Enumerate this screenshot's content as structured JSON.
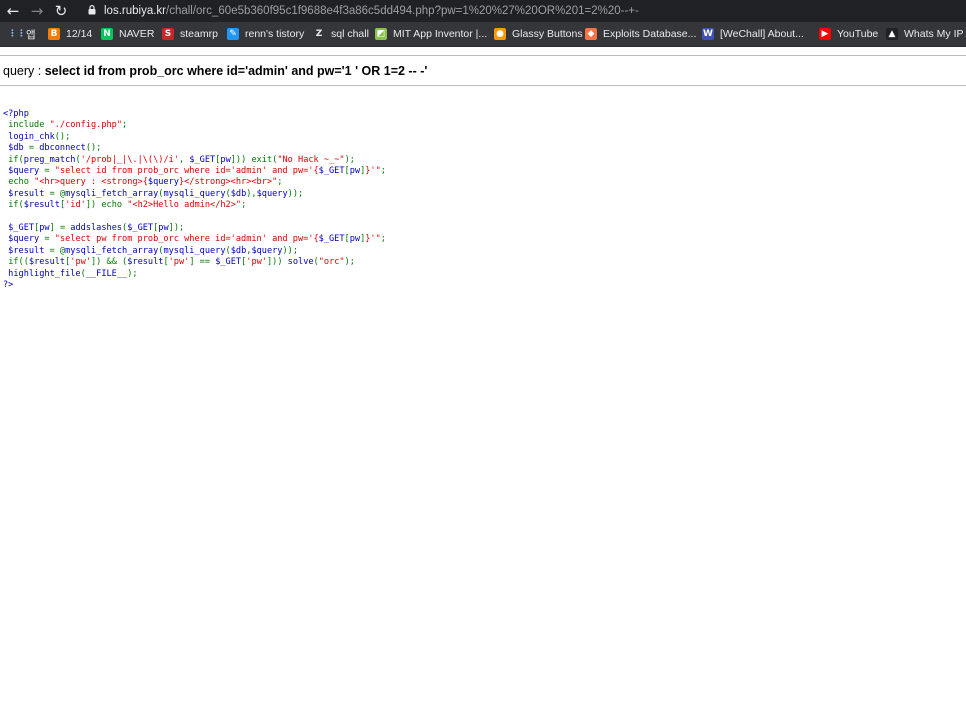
{
  "browser": {
    "url_host": "los.rubiya.kr",
    "url_path": "/chall/orc_60e5b360f95c1f9688e4f3a86c5dd494.php?pw=1%20%27%20OR%201=2%20--+-",
    "bookmarks": [
      {
        "label": "앱",
        "icon": "apps-grid-icon",
        "color": "#5f6368"
      },
      {
        "label": "12/14",
        "icon": "blogger-icon",
        "color": "#f57c00"
      },
      {
        "label": "NAVER",
        "icon": "naver-icon",
        "color": "#03c75a"
      },
      {
        "label": "steamrp",
        "icon": "steamrp-icon",
        "color": "#c62828"
      },
      {
        "label": "renn's tistory",
        "icon": "tistory-icon",
        "color": "#2196f3"
      },
      {
        "label": "sql chall",
        "icon": "z-icon",
        "color": "#e8eaed"
      },
      {
        "label": "MIT App Inventor |...",
        "icon": "app-inventor-icon",
        "color": "#8bc34a"
      },
      {
        "label": "Glassy Buttons",
        "icon": "glassy-buttons-icon",
        "color": "#ff9800"
      },
      {
        "label": "Exploits Database...",
        "icon": "exploit-db-icon",
        "color": "#ff7043"
      },
      {
        "label": "[WeChall] About...",
        "icon": "wechall-icon",
        "color": "#3f51b5"
      },
      {
        "label": "YouTube",
        "icon": "youtube-icon",
        "color": "#ff0000"
      },
      {
        "label": "Whats My IP A",
        "icon": "whatsmyip-icon",
        "color": "#202124"
      }
    ]
  },
  "page": {
    "query_label": "query : ",
    "query_value": "select id from prob_orc where id='admin' and pw='1 ' OR 1=2 -- -'"
  },
  "source_code": {
    "lines": [
      [
        [
          "default",
          "<?php"
        ]
      ],
      [
        [
          "default",
          " "
        ],
        [
          "keyword",
          "include "
        ],
        [
          "string",
          "\"./config.php\""
        ],
        [
          "keyword",
          ";"
        ]
      ],
      [
        [
          "default",
          " login_chk"
        ],
        [
          "keyword",
          "();"
        ]
      ],
      [
        [
          "default",
          " $db "
        ],
        [
          "keyword",
          "= "
        ],
        [
          "default",
          "dbconnect"
        ],
        [
          "keyword",
          "();"
        ]
      ],
      [
        [
          "default",
          " "
        ],
        [
          "keyword",
          "if("
        ],
        [
          "default",
          "preg_match"
        ],
        [
          "keyword",
          "("
        ],
        [
          "string",
          "'/prob|_|\\.|\\(\\)/i'"
        ],
        [
          "keyword",
          ", "
        ],
        [
          "default",
          "$_GET"
        ],
        [
          "keyword",
          "["
        ],
        [
          "default",
          "pw"
        ],
        [
          "keyword",
          "])) exit("
        ],
        [
          "string",
          "\"No Hack ~_~\""
        ],
        [
          "keyword",
          ");"
        ]
      ],
      [
        [
          "default",
          " $query "
        ],
        [
          "keyword",
          "= "
        ],
        [
          "string",
          "\"select id from prob_orc where id='admin' and pw='{"
        ],
        [
          "default",
          "$_GET"
        ],
        [
          "keyword",
          "["
        ],
        [
          "default",
          "pw"
        ],
        [
          "keyword",
          "]"
        ],
        [
          "string",
          "}'\""
        ],
        [
          "keyword",
          ";"
        ]
      ],
      [
        [
          "default",
          " "
        ],
        [
          "keyword",
          "echo "
        ],
        [
          "string",
          "\"<hr>query : <strong>{"
        ],
        [
          "default",
          "$query"
        ],
        [
          "string",
          "}</strong><hr><br>\""
        ],
        [
          "keyword",
          ";"
        ]
      ],
      [
        [
          "default",
          " $result "
        ],
        [
          "keyword",
          "= @"
        ],
        [
          "default",
          "mysqli_fetch_array"
        ],
        [
          "keyword",
          "("
        ],
        [
          "default",
          "mysqli_query"
        ],
        [
          "keyword",
          "("
        ],
        [
          "default",
          "$db"
        ],
        [
          "keyword",
          "),"
        ],
        [
          "default",
          "$query"
        ],
        [
          "keyword",
          "));"
        ]
      ],
      [
        [
          "default",
          " "
        ],
        [
          "keyword",
          "if("
        ],
        [
          "default",
          "$result"
        ],
        [
          "keyword",
          "["
        ],
        [
          "string",
          "'id'"
        ],
        [
          "keyword",
          "]) echo "
        ],
        [
          "string",
          "\"<h2>Hello admin</h2>\""
        ],
        [
          "keyword",
          ";"
        ]
      ],
      [
        [
          "default",
          " "
        ]
      ],
      [
        [
          "default",
          " $_GET"
        ],
        [
          "keyword",
          "["
        ],
        [
          "default",
          "pw"
        ],
        [
          "keyword",
          "] = "
        ],
        [
          "default",
          "addslashes"
        ],
        [
          "keyword",
          "("
        ],
        [
          "default",
          "$_GET"
        ],
        [
          "keyword",
          "["
        ],
        [
          "default",
          "pw"
        ],
        [
          "keyword",
          "]);"
        ]
      ],
      [
        [
          "default",
          " $query "
        ],
        [
          "keyword",
          "= "
        ],
        [
          "string",
          "\"select pw from prob_orc where id='admin' and pw='{"
        ],
        [
          "default",
          "$_GET"
        ],
        [
          "keyword",
          "["
        ],
        [
          "default",
          "pw"
        ],
        [
          "keyword",
          "]"
        ],
        [
          "string",
          "}'\""
        ],
        [
          "keyword",
          ";"
        ]
      ],
      [
        [
          "default",
          " $result "
        ],
        [
          "keyword",
          "= @"
        ],
        [
          "default",
          "mysqli_fetch_array"
        ],
        [
          "keyword",
          "("
        ],
        [
          "default",
          "mysqli_query"
        ],
        [
          "keyword",
          "("
        ],
        [
          "default",
          "$db"
        ],
        [
          "keyword",
          ","
        ],
        [
          "default",
          "$query"
        ],
        [
          "keyword",
          "));"
        ]
      ],
      [
        [
          "default",
          " "
        ],
        [
          "keyword",
          "if(("
        ],
        [
          "default",
          "$result"
        ],
        [
          "keyword",
          "["
        ],
        [
          "string",
          "'pw'"
        ],
        [
          "keyword",
          "]) && ("
        ],
        [
          "default",
          "$result"
        ],
        [
          "keyword",
          "["
        ],
        [
          "string",
          "'pw'"
        ],
        [
          "keyword",
          "] == "
        ],
        [
          "default",
          "$_GET"
        ],
        [
          "keyword",
          "["
        ],
        [
          "string",
          "'pw'"
        ],
        [
          "keyword",
          "])) "
        ],
        [
          "default",
          "solve"
        ],
        [
          "keyword",
          "("
        ],
        [
          "string",
          "\"orc\""
        ],
        [
          "keyword",
          ");"
        ]
      ],
      [
        [
          "default",
          " highlight_file"
        ],
        [
          "keyword",
          "("
        ],
        [
          "default",
          "__FILE__"
        ],
        [
          "keyword",
          ");"
        ]
      ],
      [
        [
          "default",
          "?>"
        ]
      ]
    ]
  }
}
